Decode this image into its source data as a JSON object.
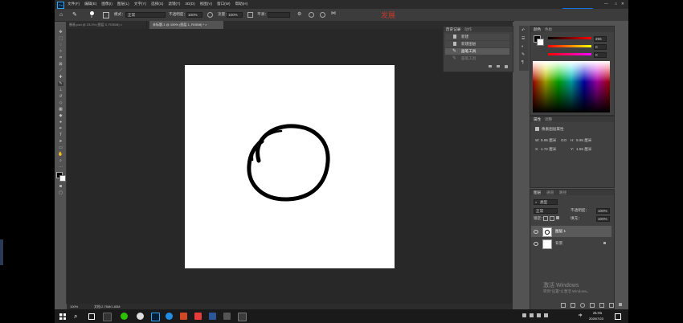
{
  "app": {
    "logo": "Ps",
    "menu": [
      "文件(F)",
      "编辑(E)",
      "图像(I)",
      "图层(L)",
      "文字(Y)",
      "选择(S)",
      "滤镜(T)",
      "3D(D)",
      "视图(V)",
      "窗口(W)",
      "帮助(H)"
    ],
    "window_controls": [
      "—",
      "□",
      "✕"
    ],
    "cloud_button": "加快上传"
  },
  "options_bar": {
    "brush_size": "5",
    "mode_label": "模式：",
    "mode_value": "正常",
    "opacity_label": "不透明度：",
    "opacity_value": "100%",
    "flow_label": "流量：",
    "flow_value": "100%",
    "smooth_label": "平滑：",
    "overlay_text": "发展"
  },
  "tabs": [
    {
      "label": "圈画.psd @ 23.2% (图层 0, RGB/8) ×",
      "active": false
    },
    {
      "label": "未标题-1 @ 100% (图层 1, RGB/8) * ×",
      "active": true
    }
  ],
  "history": {
    "tabs": [
      "历史记录",
      "动作"
    ],
    "items": [
      "新建",
      "新建图层",
      "画笔工具",
      "画笔工具"
    ]
  },
  "color": {
    "tabs": [
      "颜色",
      "色板"
    ],
    "values": [
      "255",
      "0",
      "0"
    ]
  },
  "properties": {
    "tabs": [
      "属性",
      "调整"
    ],
    "title": "像素图层属性",
    "w_label": "W:",
    "w_value": "9.95 厘米",
    "h_label": "H:",
    "h_value": "9.95 厘米",
    "x_label": "X:",
    "x_value": "1.72 厘米",
    "y_label": "Y:",
    "y_value": "1.55 厘米",
    "go_label": "GO"
  },
  "layers": {
    "tabs": [
      "图层",
      "通道",
      "路径"
    ],
    "filter": "类型",
    "blend": "正常",
    "opacity_label": "不透明度：",
    "opacity_value": "100%",
    "lock_label": "锁定：",
    "fill_label": "填充：",
    "fill_value": "100%",
    "items": [
      {
        "name": "图层 1",
        "selected": true
      },
      {
        "name": "背景",
        "selected": false
      }
    ]
  },
  "status": {
    "zoom": "100%",
    "doc_info": "文档:2.75M/1.83M"
  },
  "watermark": {
    "title": "激活 Windows",
    "subtitle": "转到\"设置\"以激活 Windows。"
  },
  "taskbar": {
    "time": "21:01",
    "date": "2020/7/23",
    "lang": "中"
  },
  "colors": {
    "accent": "#1473e6",
    "ps_blue": "#31a8ff",
    "overlay_red": "#c0392b"
  }
}
